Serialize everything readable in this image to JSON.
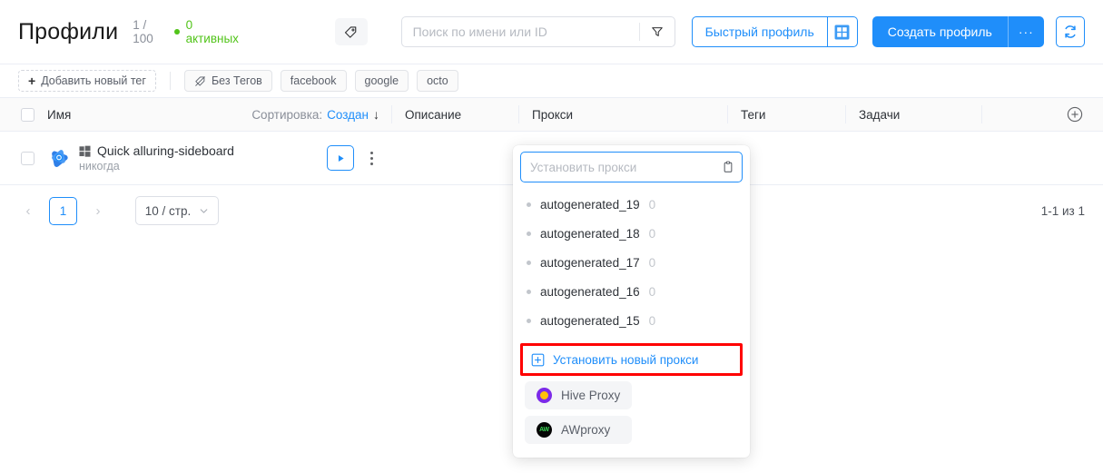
{
  "header": {
    "title": "Профили",
    "count": "1 / 100",
    "active": "0 активных",
    "tag_icon": "tag-icon",
    "search": {
      "value": "",
      "placeholder": "Поиск по имени или ID",
      "filter_icon": "funnel-icon"
    },
    "quick_profile_label": "Быстрый профиль",
    "windows_icon": "windows-icon",
    "create_profile_label": "Создать профиль",
    "create_more_label": "···",
    "refresh_icon": "refresh-icon"
  },
  "tagbar": {
    "add_label": "Добавить новый тег",
    "add_plus": "+",
    "no_tags_label": "Без Тегов",
    "tags": [
      "facebook",
      "google",
      "octo"
    ]
  },
  "table": {
    "headers": {
      "name": "Имя",
      "sort_label": "Сортировка:",
      "sort_value": "Создан",
      "sort_arrow": "↓",
      "description": "Описание",
      "proxy": "Прокси",
      "tags": "Теги",
      "tasks": "Задачи",
      "add_column_icon": "plus-circle-icon"
    },
    "rows": [
      {
        "name": "Quick alluring-sideboard",
        "subtitle": "никогда",
        "os_icon": "windows-icon",
        "browser_icon": "octo-logo-icon",
        "run_icon": "play-icon",
        "menu_icon": "kebab-menu-icon"
      }
    ]
  },
  "pagination": {
    "prev": "‹",
    "page": "1",
    "next": "›",
    "page_size": "10 / стр.",
    "page_size_caret": "⌄",
    "total": "1-1 из 1"
  },
  "proxy_dropdown": {
    "input_value": "",
    "input_placeholder": "Установить прокси",
    "clipboard_icon": "clipboard-icon",
    "items": [
      {
        "label": "autogenerated_19",
        "count": "0"
      },
      {
        "label": "autogenerated_18",
        "count": "0"
      },
      {
        "label": "autogenerated_17",
        "count": "0"
      },
      {
        "label": "autogenerated_16",
        "count": "0"
      },
      {
        "label": "autogenerated_15",
        "count": "0"
      }
    ],
    "new_proxy_label": "Установить новый прокси",
    "new_proxy_icon": "plus-box-icon",
    "providers": [
      {
        "label": "Hive Proxy",
        "icon": "hive-proxy-icon"
      },
      {
        "label": "AWproxy",
        "icon": "awproxy-icon",
        "mark": "AW"
      }
    ],
    "highlight_color": "#ff0000"
  }
}
